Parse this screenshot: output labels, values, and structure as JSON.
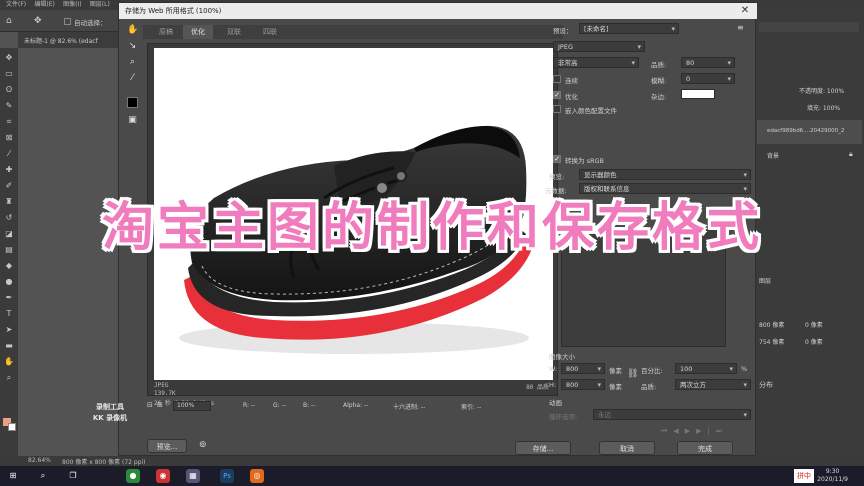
{
  "ps": {
    "menu": [
      "文件(F)",
      "编辑(E)",
      "图像(I)",
      "图层(L)"
    ],
    "auto_select_label": "自动选择：",
    "doc_tab": "未标题-1 @ 82.6% (edacf",
    "status_zoom": "82.64%",
    "status_size": "800 像素 x 800 像素 (72 ppi)"
  },
  "dialog": {
    "title": "存储为 Web 所用格式 (100%)",
    "tabs": [
      "原稿",
      "优化",
      "双联",
      "四联"
    ],
    "active_tab": "优化",
    "preview_info": {
      "format": "JPEG",
      "size": "139.7K",
      "time": "26 秒 @ 56.6 Kbps",
      "quality_right": "80 品质"
    },
    "zoom": "100%",
    "readout": {
      "r": "R: --",
      "g": "G: --",
      "b": "B: --",
      "alpha": "Alpha: --",
      "hex": "十六进制: --",
      "index": "索引: --"
    },
    "buttons": {
      "preview": "预览...",
      "save": "存储...",
      "cancel": "取消",
      "done": "完成"
    }
  },
  "settings": {
    "preset_label": "预设：",
    "preset_value": "[未命名]",
    "format_value": "JPEG",
    "compression_value": "非常高",
    "quality_label": "品质:",
    "quality_value": "80",
    "progressive_label": "连续",
    "blur_label": "模糊:",
    "blur_value": "0",
    "optimized_label": "优化",
    "matte_label": "杂边:",
    "embed_profile_label": "嵌入颜色配置文件",
    "convert_srgb_label": "转换为 sRGB",
    "preview_label": "预览:",
    "preview_value": "显示器颜色",
    "metadata_label": "元数据:",
    "metadata_value": "版权和联系信息",
    "color_table_label": "颜色表",
    "image_size_label": "图像大小",
    "w_label": "W:",
    "w_value": "800",
    "h_label": "H:",
    "h_value": "800",
    "px_unit": "像素",
    "percent_label": "百分比:",
    "percent_value": "100",
    "percent_unit": "%",
    "quality2_label": "品质:",
    "quality2_value": "两次立方",
    "animation_label": "动画",
    "loop_label": "循环选项:",
    "loop_value": "永远"
  },
  "right_panel": {
    "opacity": "不透明度: 100%",
    "fill": "填充: 100%",
    "layer_name": "edacf989bd6....20429000_2",
    "bg_layer": "背景",
    "w_field": "800 像素",
    "h_field": "754 像素",
    "zero": "0 像素",
    "section": "分布"
  },
  "overlay_caption": "淘宝主图的制作和保存格式",
  "watermark": [
    "录制工具",
    "KK 录像机"
  ],
  "taskbar": {
    "ime": "拼中",
    "time": "9:30",
    "date": "2020/11/9"
  },
  "colors": {
    "caption_pink": "#f07bbd",
    "sole_red": "#e8303a"
  }
}
